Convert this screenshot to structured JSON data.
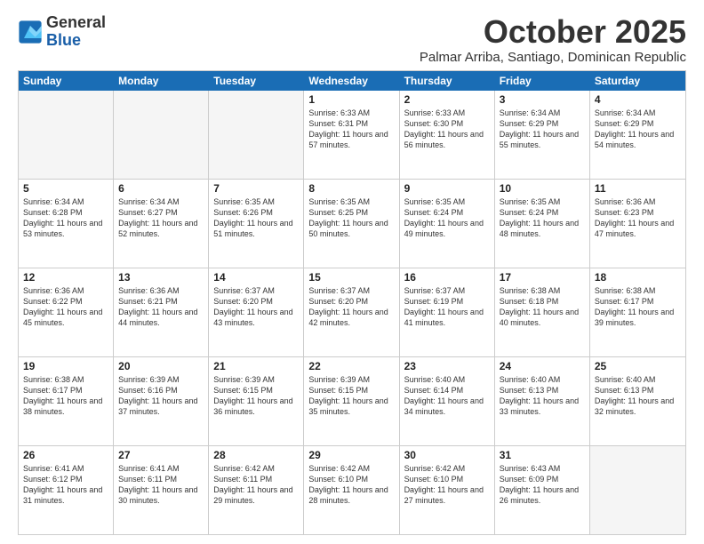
{
  "logo": {
    "general": "General",
    "blue": "Blue"
  },
  "title": "October 2025",
  "subtitle": "Palmar Arriba, Santiago, Dominican Republic",
  "headers": [
    "Sunday",
    "Monday",
    "Tuesday",
    "Wednesday",
    "Thursday",
    "Friday",
    "Saturday"
  ],
  "weeks": [
    [
      {
        "day": "",
        "info": ""
      },
      {
        "day": "",
        "info": ""
      },
      {
        "day": "",
        "info": ""
      },
      {
        "day": "1",
        "info": "Sunrise: 6:33 AM\nSunset: 6:31 PM\nDaylight: 11 hours and 57 minutes."
      },
      {
        "day": "2",
        "info": "Sunrise: 6:33 AM\nSunset: 6:30 PM\nDaylight: 11 hours and 56 minutes."
      },
      {
        "day": "3",
        "info": "Sunrise: 6:34 AM\nSunset: 6:29 PM\nDaylight: 11 hours and 55 minutes."
      },
      {
        "day": "4",
        "info": "Sunrise: 6:34 AM\nSunset: 6:29 PM\nDaylight: 11 hours and 54 minutes."
      }
    ],
    [
      {
        "day": "5",
        "info": "Sunrise: 6:34 AM\nSunset: 6:28 PM\nDaylight: 11 hours and 53 minutes."
      },
      {
        "day": "6",
        "info": "Sunrise: 6:34 AM\nSunset: 6:27 PM\nDaylight: 11 hours and 52 minutes."
      },
      {
        "day": "7",
        "info": "Sunrise: 6:35 AM\nSunset: 6:26 PM\nDaylight: 11 hours and 51 minutes."
      },
      {
        "day": "8",
        "info": "Sunrise: 6:35 AM\nSunset: 6:25 PM\nDaylight: 11 hours and 50 minutes."
      },
      {
        "day": "9",
        "info": "Sunrise: 6:35 AM\nSunset: 6:24 PM\nDaylight: 11 hours and 49 minutes."
      },
      {
        "day": "10",
        "info": "Sunrise: 6:35 AM\nSunset: 6:24 PM\nDaylight: 11 hours and 48 minutes."
      },
      {
        "day": "11",
        "info": "Sunrise: 6:36 AM\nSunset: 6:23 PM\nDaylight: 11 hours and 47 minutes."
      }
    ],
    [
      {
        "day": "12",
        "info": "Sunrise: 6:36 AM\nSunset: 6:22 PM\nDaylight: 11 hours and 45 minutes."
      },
      {
        "day": "13",
        "info": "Sunrise: 6:36 AM\nSunset: 6:21 PM\nDaylight: 11 hours and 44 minutes."
      },
      {
        "day": "14",
        "info": "Sunrise: 6:37 AM\nSunset: 6:20 PM\nDaylight: 11 hours and 43 minutes."
      },
      {
        "day": "15",
        "info": "Sunrise: 6:37 AM\nSunset: 6:20 PM\nDaylight: 11 hours and 42 minutes."
      },
      {
        "day": "16",
        "info": "Sunrise: 6:37 AM\nSunset: 6:19 PM\nDaylight: 11 hours and 41 minutes."
      },
      {
        "day": "17",
        "info": "Sunrise: 6:38 AM\nSunset: 6:18 PM\nDaylight: 11 hours and 40 minutes."
      },
      {
        "day": "18",
        "info": "Sunrise: 6:38 AM\nSunset: 6:17 PM\nDaylight: 11 hours and 39 minutes."
      }
    ],
    [
      {
        "day": "19",
        "info": "Sunrise: 6:38 AM\nSunset: 6:17 PM\nDaylight: 11 hours and 38 minutes."
      },
      {
        "day": "20",
        "info": "Sunrise: 6:39 AM\nSunset: 6:16 PM\nDaylight: 11 hours and 37 minutes."
      },
      {
        "day": "21",
        "info": "Sunrise: 6:39 AM\nSunset: 6:15 PM\nDaylight: 11 hours and 36 minutes."
      },
      {
        "day": "22",
        "info": "Sunrise: 6:39 AM\nSunset: 6:15 PM\nDaylight: 11 hours and 35 minutes."
      },
      {
        "day": "23",
        "info": "Sunrise: 6:40 AM\nSunset: 6:14 PM\nDaylight: 11 hours and 34 minutes."
      },
      {
        "day": "24",
        "info": "Sunrise: 6:40 AM\nSunset: 6:13 PM\nDaylight: 11 hours and 33 minutes."
      },
      {
        "day": "25",
        "info": "Sunrise: 6:40 AM\nSunset: 6:13 PM\nDaylight: 11 hours and 32 minutes."
      }
    ],
    [
      {
        "day": "26",
        "info": "Sunrise: 6:41 AM\nSunset: 6:12 PM\nDaylight: 11 hours and 31 minutes."
      },
      {
        "day": "27",
        "info": "Sunrise: 6:41 AM\nSunset: 6:11 PM\nDaylight: 11 hours and 30 minutes."
      },
      {
        "day": "28",
        "info": "Sunrise: 6:42 AM\nSunset: 6:11 PM\nDaylight: 11 hours and 29 minutes."
      },
      {
        "day": "29",
        "info": "Sunrise: 6:42 AM\nSunset: 6:10 PM\nDaylight: 11 hours and 28 minutes."
      },
      {
        "day": "30",
        "info": "Sunrise: 6:42 AM\nSunset: 6:10 PM\nDaylight: 11 hours and 27 minutes."
      },
      {
        "day": "31",
        "info": "Sunrise: 6:43 AM\nSunset: 6:09 PM\nDaylight: 11 hours and 26 minutes."
      },
      {
        "day": "",
        "info": ""
      }
    ]
  ]
}
